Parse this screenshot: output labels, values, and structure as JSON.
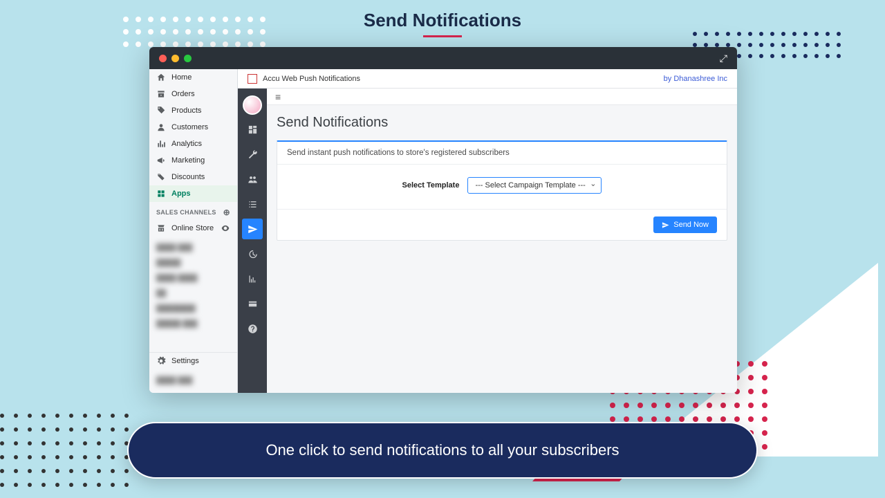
{
  "marketing": {
    "title": "Send Notifications",
    "caption": "One click to send notifications to all your subscribers"
  },
  "app_header": {
    "app_name": "Accu Web Push Notifications",
    "vendor": "by Dhanashree Inc"
  },
  "shopify_nav": {
    "items": [
      {
        "label": "Home",
        "icon": "home"
      },
      {
        "label": "Orders",
        "icon": "orders"
      },
      {
        "label": "Products",
        "icon": "tag"
      },
      {
        "label": "Customers",
        "icon": "user"
      },
      {
        "label": "Analytics",
        "icon": "analytics"
      },
      {
        "label": "Marketing",
        "icon": "megaphone"
      },
      {
        "label": "Discounts",
        "icon": "discount"
      },
      {
        "label": "Apps",
        "icon": "apps",
        "active": true
      }
    ],
    "sales_channels_heading": "SALES CHANNELS",
    "online_store": "Online Store",
    "settings": "Settings"
  },
  "icon_rail": [
    {
      "name": "dashboard",
      "active": false
    },
    {
      "name": "wrench",
      "active": false
    },
    {
      "name": "users",
      "active": false
    },
    {
      "name": "list",
      "active": false
    },
    {
      "name": "send",
      "active": true
    },
    {
      "name": "history",
      "active": false
    },
    {
      "name": "chart",
      "active": false
    },
    {
      "name": "card",
      "active": false
    },
    {
      "name": "help",
      "active": false
    }
  ],
  "page": {
    "title": "Send Notifications",
    "description": "Send instant push notifications to store's registered subscribers",
    "select_label": "Select Template",
    "select_placeholder": "--- Select Campaign Template ---",
    "send_button": "Send Now"
  }
}
